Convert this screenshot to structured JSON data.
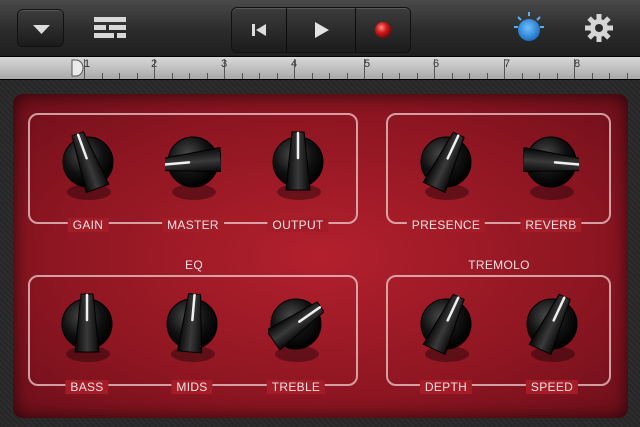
{
  "toolbar": {
    "menu_icon": "chevron-down-icon",
    "tracks_icon": "track-view-icon",
    "rewind_icon": "skip-back-icon",
    "play_icon": "play-icon",
    "record_icon": "record-icon",
    "tuner_icon": "tuner-knob-icon",
    "settings_icon": "gear-icon",
    "tuner_color": "#2b8de0",
    "record_color": "#d31a1a"
  },
  "ruler": {
    "numbers": [
      "1",
      "2",
      "3",
      "4",
      "5",
      "6",
      "7",
      "8"
    ]
  },
  "amp": {
    "panel_color": "#9a1a26",
    "knobs": [
      {
        "label": "GAIN",
        "group": "main"
      },
      {
        "label": "MASTER",
        "group": "main"
      },
      {
        "label": "OUTPUT",
        "group": "main"
      },
      {
        "label": "PRESENCE",
        "group": "presence"
      },
      {
        "label": "REVERB",
        "group": "presence"
      },
      {
        "label": "BASS",
        "group": "eq"
      },
      {
        "label": "MIDS",
        "group": "eq"
      },
      {
        "label": "TREBLE",
        "group": "eq"
      },
      {
        "label": "DEPTH",
        "group": "tremolo"
      },
      {
        "label": "SPEED",
        "group": "tremolo"
      }
    ],
    "eq_title": "EQ",
    "tremolo_title": "TREMOLO"
  }
}
